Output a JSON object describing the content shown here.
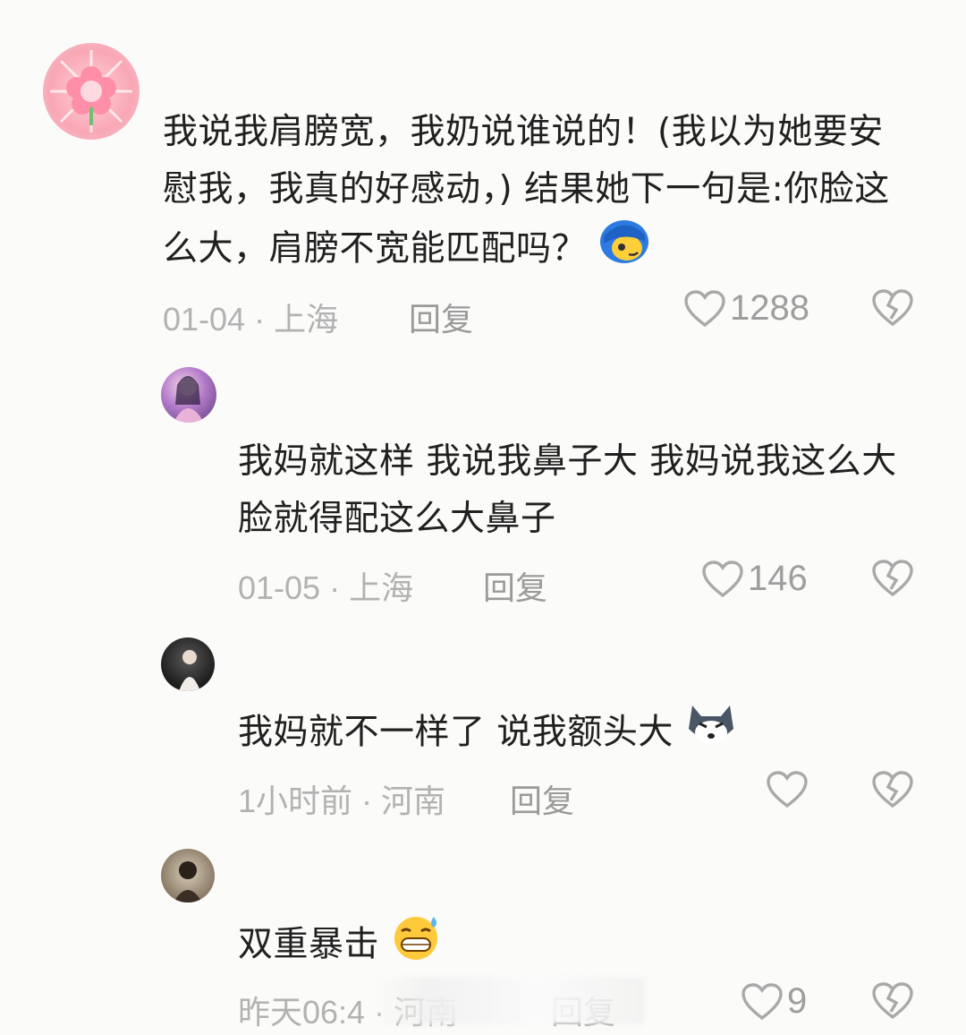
{
  "comments": [
    {
      "text": "我说我肩膀宽，我奶说谁说的！(我以为她要安慰我，我真的好感动，) 结果她下一句是:你脸这么大，肩膀不宽能匹配吗？",
      "date": "01-04",
      "location": "上海",
      "reply_label": "回复",
      "likes": "1288"
    },
    {
      "text": "我妈就这样 我说我鼻子大 我妈说我这么大脸就得配这么大鼻子",
      "date": "01-05",
      "location": "上海",
      "reply_label": "回复",
      "likes": "146"
    },
    {
      "text": "我妈就不一样了 说我额头大",
      "date": "1小时前",
      "location": "河南",
      "reply_label": "回复",
      "likes": ""
    },
    {
      "text": "双重暴击",
      "date": "昨天06:4",
      "location": "河南",
      "reply_label": "回复",
      "likes": "9"
    }
  ],
  "separator": "·"
}
